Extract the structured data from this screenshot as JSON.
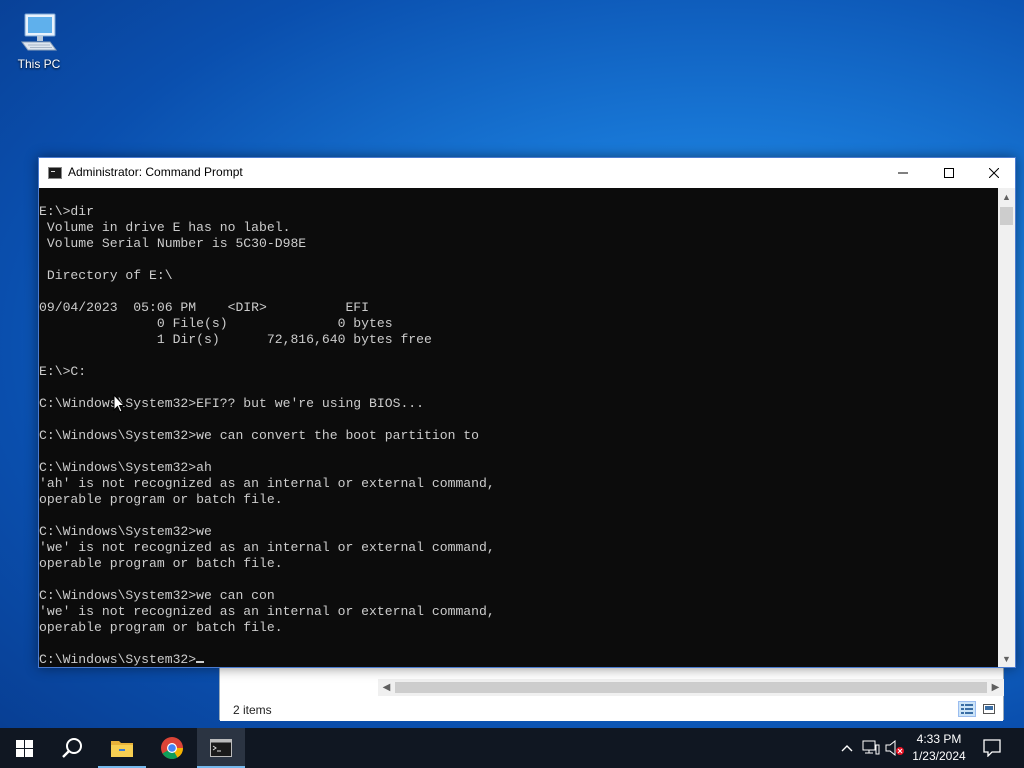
{
  "desktop": {
    "icons": [
      {
        "label": "This PC",
        "icon": "computer-icon"
      }
    ]
  },
  "explorer": {
    "status_count": "2 items"
  },
  "cmd_window": {
    "title": "Administrator: Command Prompt",
    "console_lines": [
      "E:\\>dir",
      " Volume in drive E has no label.",
      " Volume Serial Number is 5C30-D98E",
      "",
      " Directory of E:\\",
      "",
      "09/04/2023  05:06 PM    <DIR>          EFI",
      "               0 File(s)              0 bytes",
      "               1 Dir(s)      72,816,640 bytes free",
      "",
      "E:\\>C:",
      "",
      "C:\\Windows\\System32>EFI?? but we're using BIOS...",
      "",
      "C:\\Windows\\System32>we can convert the boot partition to",
      "",
      "C:\\Windows\\System32>ah",
      "'ah' is not recognized as an internal or external command,",
      "operable program or batch file.",
      "",
      "C:\\Windows\\System32>we",
      "'we' is not recognized as an internal or external command,",
      "operable program or batch file.",
      "",
      "C:\\Windows\\System32>we can con",
      "'we' is not recognized as an internal or external command,",
      "operable program or batch file.",
      ""
    ],
    "prompt": "C:\\Windows\\System32>"
  },
  "taskbar": {
    "apps": [
      {
        "name": "start",
        "icon": "windows-logo-icon"
      },
      {
        "name": "search",
        "icon": "search-icon"
      },
      {
        "name": "file-explorer",
        "icon": "folder-icon"
      },
      {
        "name": "chrome",
        "icon": "chrome-icon"
      },
      {
        "name": "command-prompt",
        "icon": "terminal-icon",
        "active": true
      }
    ],
    "clock": {
      "time": "4:33 PM",
      "date": "1/23/2024"
    }
  },
  "colors": {
    "console_bg": "#0c0c0c",
    "console_text": "#cccccc",
    "taskbar_bg": "#101722",
    "accent": "#76b9ed"
  }
}
